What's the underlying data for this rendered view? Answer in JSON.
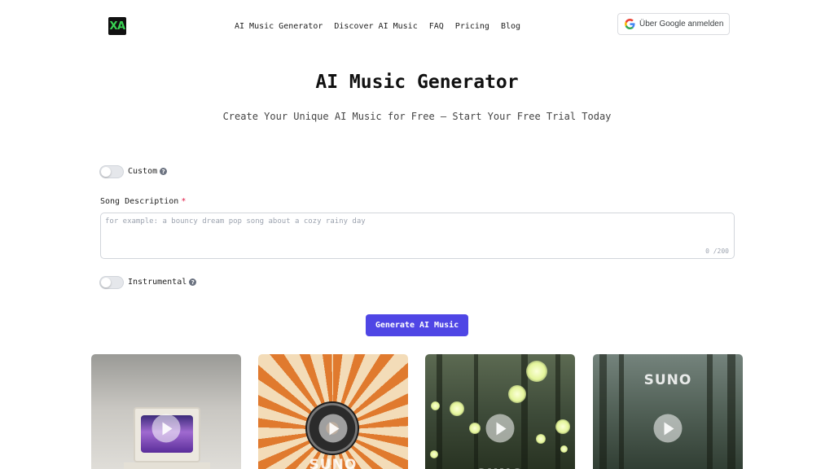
{
  "logo": {
    "text": "XA"
  },
  "nav": {
    "items": [
      "AI Music Generator",
      "Discover AI Music",
      "FAQ",
      "Pricing",
      "Blog"
    ]
  },
  "google_button": {
    "label": "Über Google anmelden",
    "icon": "google-g-icon"
  },
  "hero": {
    "title": "AI Music Generator",
    "subtitle": "Create Your Unique AI Music for Free – Start Your Free Trial Today"
  },
  "form": {
    "custom_label": "Custom",
    "custom_enabled": false,
    "song_description_label": "Song Description",
    "required_mark": "*",
    "song_description_placeholder": "for example: a bouncy dream pop song about a cozy rainy day",
    "song_description_value": "",
    "char_counter": "0 /200",
    "instrumental_label": "Instrumental",
    "instrumental_enabled": false,
    "help_icon": "?",
    "generate_label": "Generate AI Music"
  },
  "cards": {
    "watermark": "SUNO",
    "items": [
      {
        "icon": "play-icon",
        "accent": "#a06ad0"
      },
      {
        "icon": "play-icon",
        "accent": "#e07a2e"
      },
      {
        "icon": "play-icon",
        "accent": "#e4f59a"
      },
      {
        "icon": "play-icon",
        "accent": "#74837c"
      }
    ]
  },
  "colors": {
    "primary": "#4f46e5",
    "logo_accent": "#39d353",
    "required": "#e11d48"
  }
}
